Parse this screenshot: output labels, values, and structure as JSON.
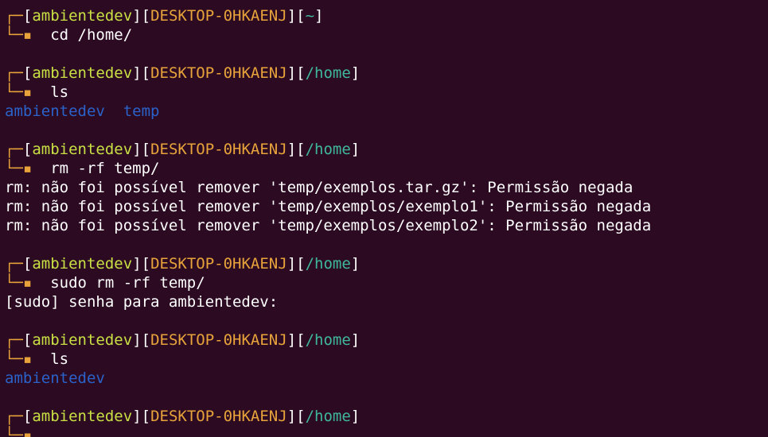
{
  "terminal": {
    "prompt": {
      "top_frame": "┌─",
      "bottom_frame": "└─▪",
      "open_bracket": "[",
      "close_bracket": "]",
      "user": "ambientedev",
      "host": "DESKTOP-0HKAENJ"
    },
    "blocks": [
      {
        "path": "~",
        "command": "cd /home/",
        "output": []
      },
      {
        "path": "/home",
        "command": "ls",
        "output": [],
        "listing": [
          "ambientedev",
          "temp"
        ]
      },
      {
        "path": "/home",
        "command": "rm -rf temp/",
        "output": [
          "rm: não foi possível remover 'temp/exemplos.tar.gz': Permissão negada",
          "rm: não foi possível remover 'temp/exemplos/exemplo1': Permissão negada",
          "rm: não foi possível remover 'temp/exemplos/exemplo2': Permissão negada"
        ]
      },
      {
        "path": "/home",
        "command": "sudo rm -rf temp/",
        "output": [
          "[sudo] senha para ambientedev:"
        ]
      },
      {
        "path": "/home",
        "command": "ls",
        "output": [],
        "listing": [
          "ambientedev"
        ]
      },
      {
        "path": "/home",
        "command": "",
        "output": []
      }
    ]
  },
  "colors": {
    "background": "#2c0a22",
    "frame": "#e8a33a",
    "user": "#c8e043",
    "host": "#e8a33a",
    "path": "#3fb89a",
    "directory": "#2a62c9",
    "text": "#ffffff"
  }
}
